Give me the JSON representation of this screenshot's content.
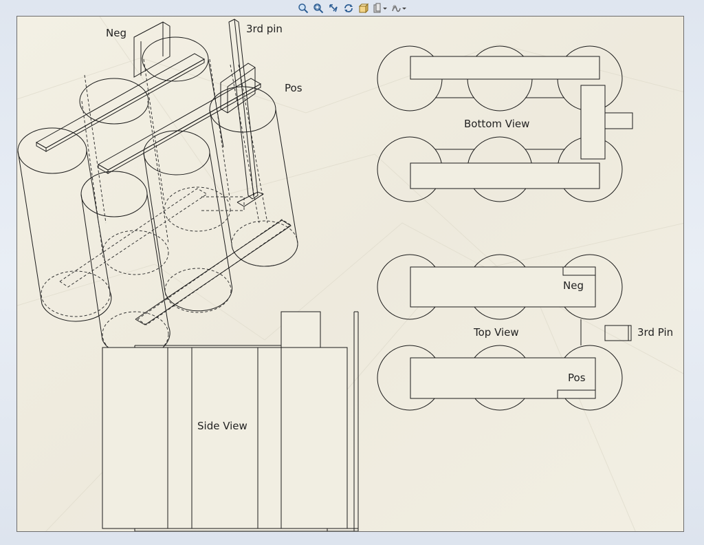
{
  "toolbar": {
    "buttons": [
      {
        "name": "zoom-to-fit-icon"
      },
      {
        "name": "zoom-to-area-icon"
      },
      {
        "name": "previous-view-icon"
      },
      {
        "name": "rotate-view-icon"
      },
      {
        "name": "3d-drawing-view-icon"
      },
      {
        "name": "hide-show-items-icon"
      },
      {
        "name": "apply-scene-icon"
      }
    ]
  },
  "labels": {
    "neg_iso": "Neg",
    "third_pin_iso": "3rd pin",
    "pos_iso": "Pos",
    "bottom_view": "Bottom View",
    "top_view": "Top View",
    "neg_top": "Neg",
    "third_pin_top": "3rd Pin",
    "pos_top": "Pos",
    "side_view": "Side View"
  },
  "colors": {
    "sheet_bg": "#f1eee2",
    "line": "#1a1a1a",
    "hidden_line": "#333333"
  }
}
